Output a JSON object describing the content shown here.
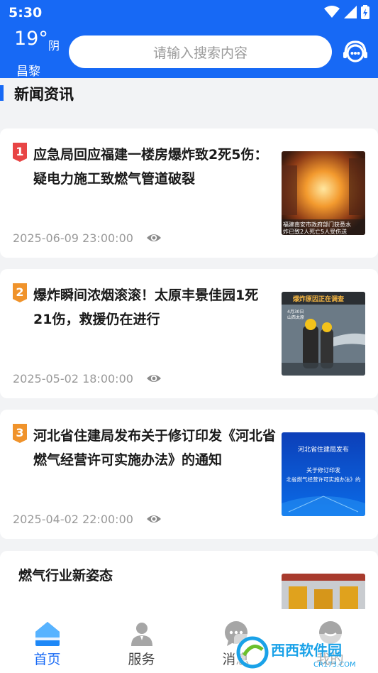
{
  "status": {
    "time": "5:30"
  },
  "weather": {
    "temperature": "19°",
    "condition": "阴",
    "city": "昌黎"
  },
  "search": {
    "placeholder": "请输入搜索内容"
  },
  "section": {
    "title": "新闻资讯"
  },
  "news": [
    {
      "rank": "1",
      "rank_color": "#e84545",
      "title": "应急局回应福建一楼房爆炸致2死5伤：疑电力施工致燃气管道破裂",
      "date": "2025-06-09 23:00:00",
      "thumb_lines": [
        "福建南安市政府部门获悉水",
        "炸已致2人死亡5人受伤送"
      ]
    },
    {
      "rank": "2",
      "rank_color": "#f0932b",
      "title": "爆炸瞬间浓烟滚滚！太原丰景佳园1死21伤，救援仍在进行",
      "date": "2025-05-02 18:00:00",
      "thumb_lines": [
        "爆炸原因正在调查",
        "4月30日",
        "山西太原"
      ]
    },
    {
      "rank": "3",
      "rank_color": "#f0932b",
      "title": "河北省住建局发布关于修订印发《河北省燃气经营许可实施办法》的通知",
      "date": "2025-04-02 22:00:00",
      "thumb_lines": [
        "河北省住建局发布",
        "关于修订印发",
        "北省燃气经营许可实施办法》的"
      ]
    }
  ],
  "partial_card": {
    "title": "燃气行业新姿态"
  },
  "tabs": [
    {
      "label": "首页",
      "icon": "home-icon",
      "active": true
    },
    {
      "label": "服务",
      "icon": "person-icon",
      "active": false
    },
    {
      "label": "消息",
      "icon": "chat-icon",
      "active": false
    },
    {
      "label": "我的",
      "icon": "profile-icon",
      "active": false
    }
  ],
  "watermark": {
    "text": "西西软件园",
    "sub": "CR173.COM"
  },
  "colors": {
    "brand": "#1769f5",
    "background": "#f2f3f5"
  }
}
